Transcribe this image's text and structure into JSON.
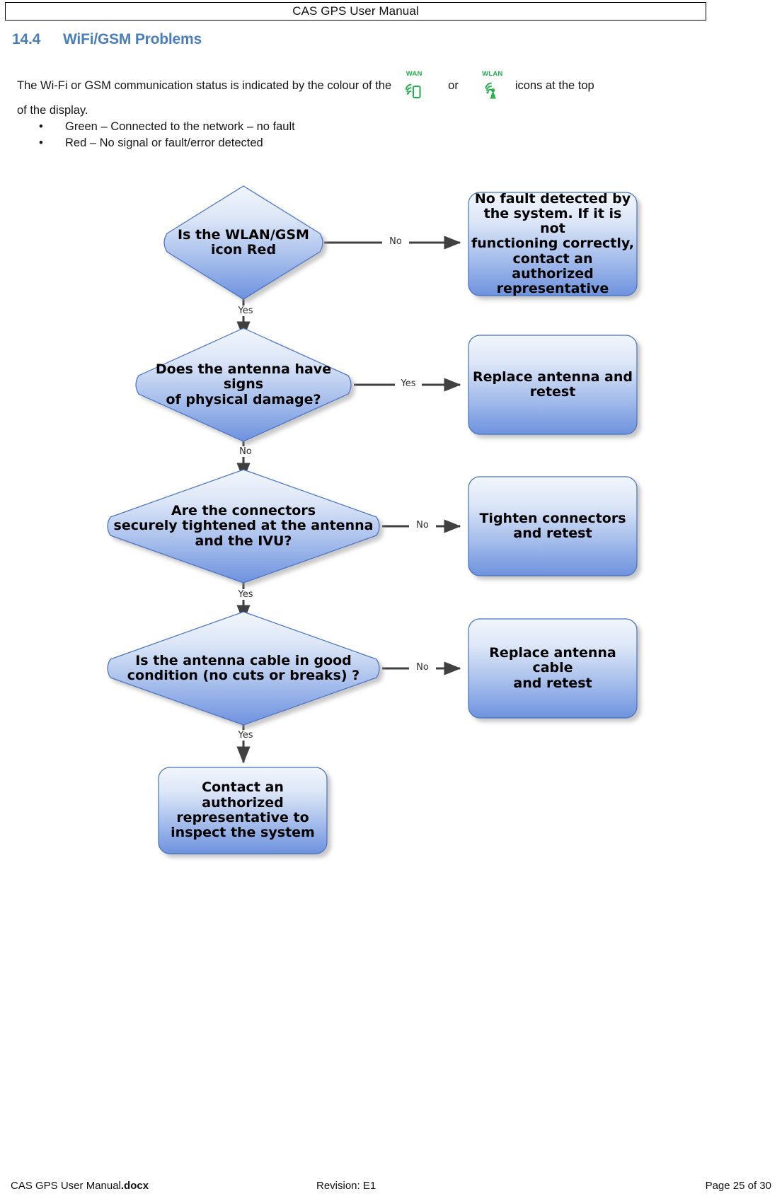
{
  "header": {
    "title": "CAS GPS User Manual"
  },
  "section": {
    "number": "14.4",
    "title": "WiFi/GSM Problems",
    "heading_color": "#4A7EBB"
  },
  "intro": {
    "text_part_1": "The Wi-Fi or GSM communication status is indicated by the colour of the",
    "icon_wan_label": "WAN",
    "icon_wan_name": "wan-signal-phone-icon",
    "or_word": "or",
    "icon_wlan_label": "WLAN",
    "icon_wlan_name": "wlan-signal-tower-icon",
    "text_part_2": "icons at the top",
    "text_line_2": "of the display.",
    "icon_color": "#22B14C"
  },
  "bullets": [
    {
      "marker": "•",
      "text": "Green – Connected to the network – no fault"
    },
    {
      "marker": "•",
      "text": "Red – No signal or fault/error detected"
    }
  ],
  "flowchart": {
    "type": "flowchart",
    "shape_gradient_top": "#EDF2FB",
    "shape_gradient_bottom": "#6E92DE",
    "shape_border": "#4472C4",
    "connector_color": "#404040",
    "nodes": [
      {
        "id": "d1",
        "shape": "diamond",
        "text": "Is the WLAN/GSM\nicon Red",
        "font_size": 19
      },
      {
        "id": "b1",
        "shape": "rounded-rect",
        "text": "No fault detected by\nthe system. If it is not\nfunctioning correctly,\ncontact an authorized\nrepresentative",
        "font_size": 19
      },
      {
        "id": "d2",
        "shape": "diamond",
        "text": "Does the antenna have signs\nof physical damage?",
        "font_size": 19
      },
      {
        "id": "b2",
        "shape": "rounded-rect",
        "text": "Replace antenna and\nretest",
        "font_size": 19
      },
      {
        "id": "d3",
        "shape": "diamond",
        "text": "Are the connectors\nsecurely tightened at the antenna\nand the IVU?",
        "font_size": 19
      },
      {
        "id": "b3",
        "shape": "rounded-rect",
        "text": "Tighten connectors\nand retest",
        "font_size": 19
      },
      {
        "id": "d4",
        "shape": "diamond",
        "text": "Is the antenna cable in good\ncondition (no cuts or breaks) ?",
        "font_size": 19
      },
      {
        "id": "b4",
        "shape": "rounded-rect",
        "text": "Replace antenna cable\nand retest",
        "font_size": 19
      },
      {
        "id": "b5",
        "shape": "rounded-rect",
        "text": "Contact an authorized\nrepresentative to\ninspect the system",
        "font_size": 19
      }
    ],
    "edges": [
      {
        "from": "d1",
        "to": "b1",
        "label": "No"
      },
      {
        "from": "d1",
        "to": "d2",
        "label": "Yes"
      },
      {
        "from": "d2",
        "to": "b2",
        "label": "Yes"
      },
      {
        "from": "d2",
        "to": "d3",
        "label": "No"
      },
      {
        "from": "d3",
        "to": "b3",
        "label": "No"
      },
      {
        "from": "d3",
        "to": "d4",
        "label": "Yes"
      },
      {
        "from": "d4",
        "to": "b4",
        "label": "No"
      },
      {
        "from": "d4",
        "to": "b5",
        "label": "Yes"
      }
    ]
  },
  "footer": {
    "doc_name": "CAS GPS User Manual",
    "doc_ext": ".docx",
    "revision": "Revision: E1",
    "page": "Page 25 of 30"
  }
}
